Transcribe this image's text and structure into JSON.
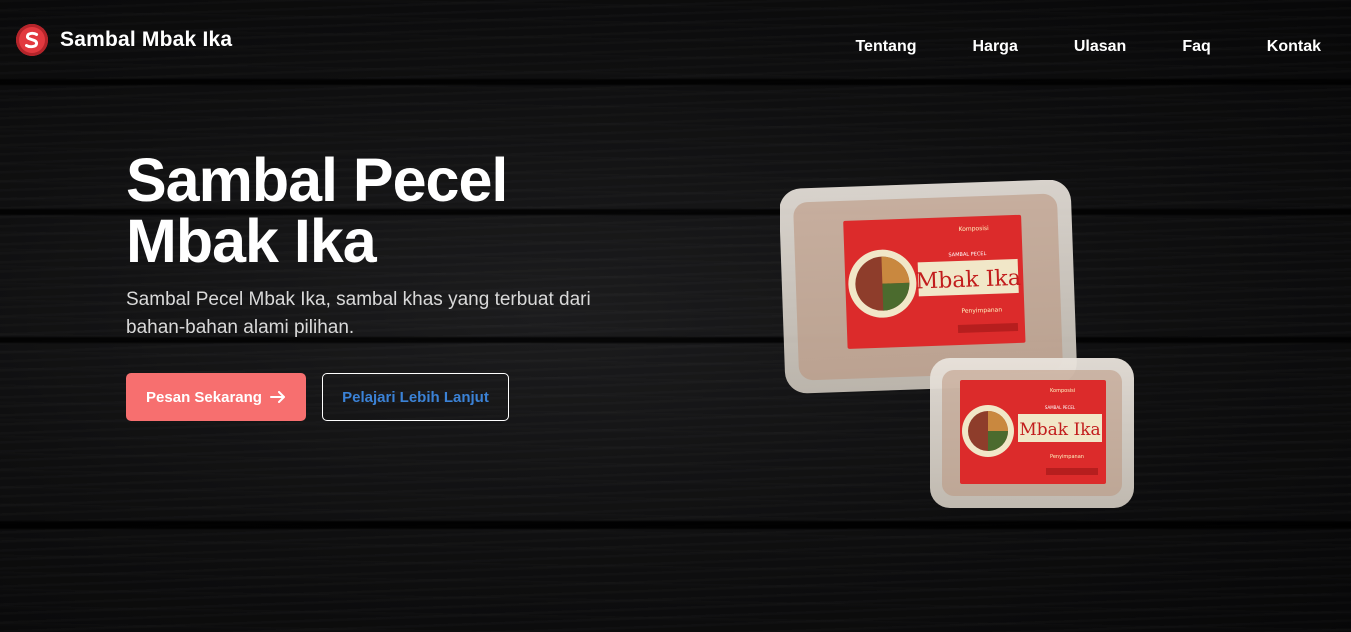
{
  "brand": {
    "name": "Sambal Mbak Ika",
    "logo_letter": "S",
    "color": "#e2393f"
  },
  "nav": [
    {
      "label": "Tentang"
    },
    {
      "label": "Harga"
    },
    {
      "label": "Ulasan"
    },
    {
      "label": "Faq"
    },
    {
      "label": "Kontak"
    }
  ],
  "hero": {
    "title_line1": "Sambal Pecel",
    "title_line2": "Mbak Ika",
    "subtitle": "Sambal Pecel Mbak Ika, sambal khas yang terbuat dari bahan-bahan alami pilihan.",
    "primary_button": "Pesan Sekarang",
    "primary_icon": "arrow-right-icon",
    "secondary_button": "Pelajari Lebih Lanjut",
    "primary_color": "#f76f6f",
    "secondary_text_color": "#3b82d6"
  },
  "product_label": {
    "brand": "Mbak Ika",
    "small_top": "SAMBAL PECEL",
    "composition_title": "Komposisi",
    "storage_title": "Penyimpanan"
  }
}
